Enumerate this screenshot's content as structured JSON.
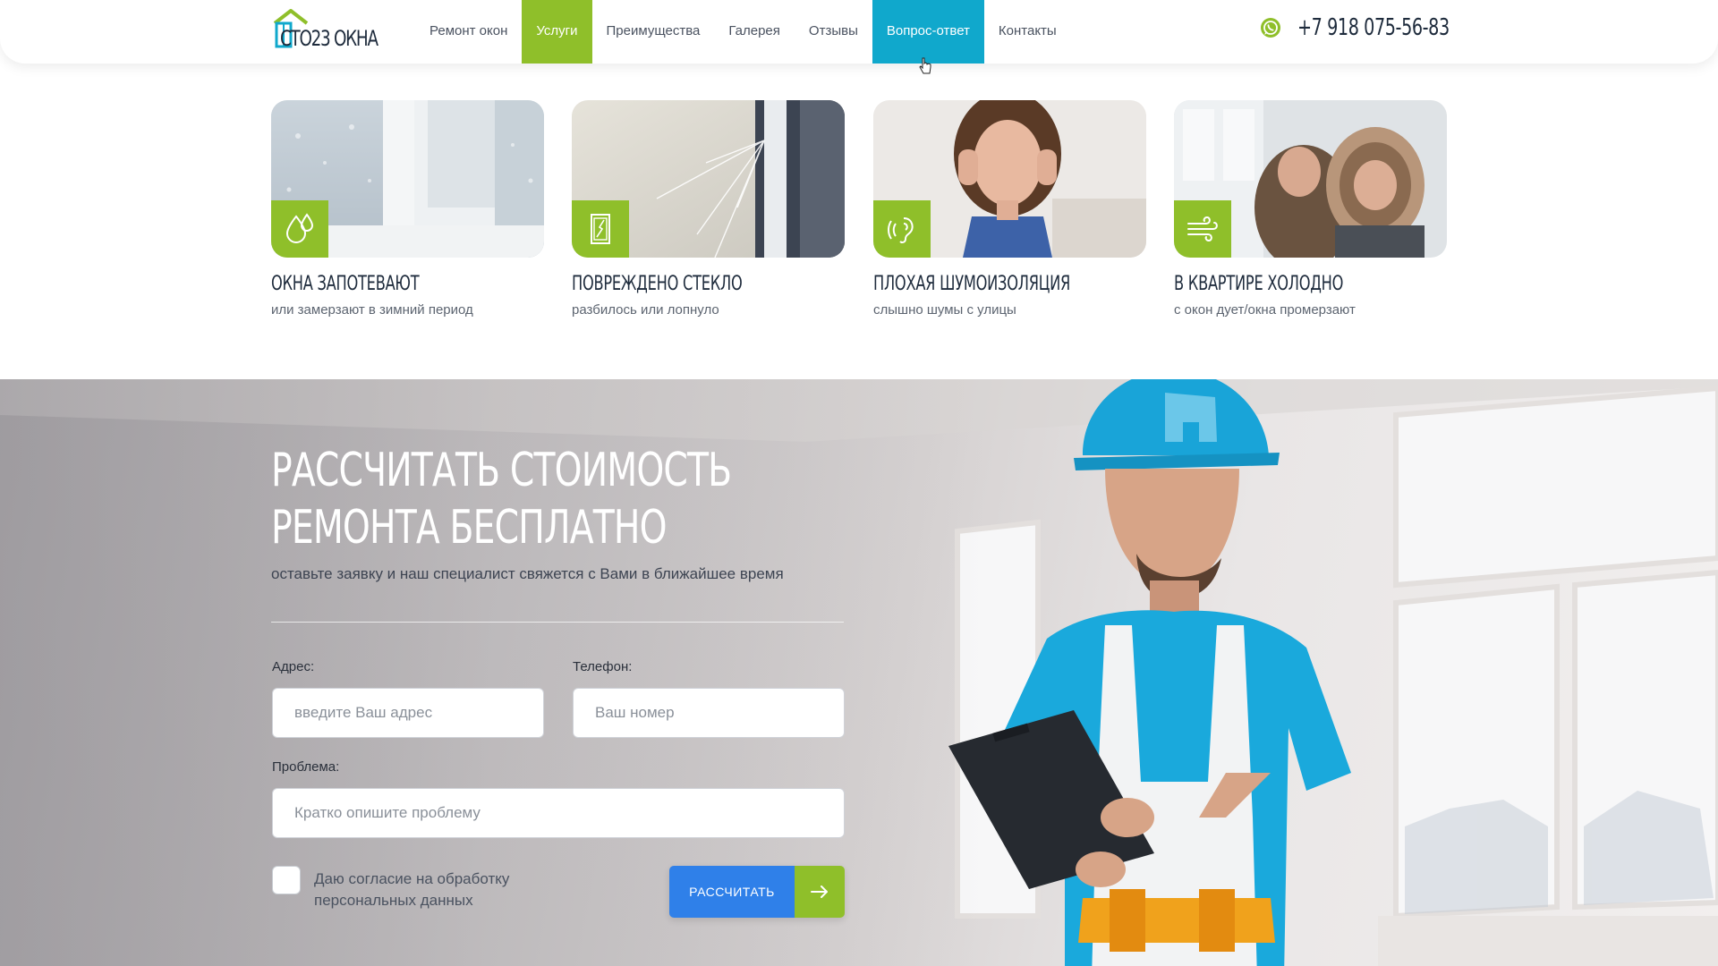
{
  "header": {
    "logo_text": "СТО23 ОКНА",
    "nav": [
      {
        "label": "Ремонт окон",
        "state": "normal"
      },
      {
        "label": "Услуги",
        "state": "active"
      },
      {
        "label": "Преимущества",
        "state": "normal"
      },
      {
        "label": "Галерея",
        "state": "normal"
      },
      {
        "label": "Отзывы",
        "state": "normal"
      },
      {
        "label": "Вопрос-ответ",
        "state": "hover"
      },
      {
        "label": "Контакты",
        "state": "normal"
      }
    ],
    "phone_icon": "whatsapp-icon",
    "phone": "+7 918 075-56-83"
  },
  "problems": [
    {
      "title": "Окна запотевают",
      "subtitle": "или замерзают в зимний период",
      "icon": "droplets-icon"
    },
    {
      "title": "Повреждено стекло",
      "subtitle": "разбилось или лопнуло",
      "icon": "broken-glass-icon"
    },
    {
      "title": "Плохая шумоизоляция",
      "subtitle": "слышно шумы с улицы",
      "icon": "ear-sound-icon"
    },
    {
      "title": "В квартире холодно",
      "subtitle": "с окон дует/окна промерзают",
      "icon": "wind-icon"
    }
  ],
  "cta": {
    "title_line1": "Рассчитать стоимость",
    "title_line2": "ремонта бесплатно",
    "subtitle": "оставьте заявку и наш специалист свяжется с Вами в ближайшее время",
    "address_label": "Адрес:",
    "address_placeholder": "введите Ваш адрес",
    "phone_label": "Телефон:",
    "phone_placeholder": "Ваш номер",
    "problem_label": "Проблема:",
    "problem_placeholder": "Кратко опишите проблему",
    "consent": "Даю согласие на обработку персональных данных",
    "consent_checked": false,
    "button_label": "РАССЧИТАТЬ",
    "button_icon": "arrow-right-icon"
  },
  "colors": {
    "green": "#8fbf2a",
    "blue_nav": "#10a8cc",
    "blue_button": "#2f80e9",
    "dark_text": "#1e2b3c"
  }
}
